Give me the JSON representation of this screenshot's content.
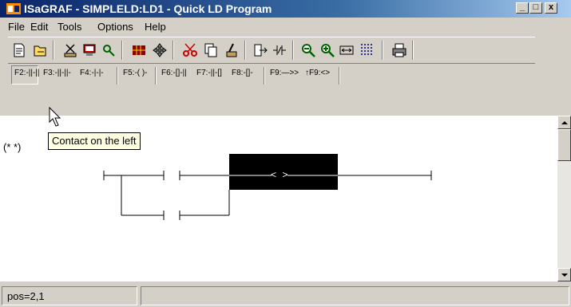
{
  "window": {
    "title": "ISaGRAF - SIMPLELD:LD1 - Quick LD Program",
    "controls": [
      "_",
      "□",
      "x"
    ]
  },
  "menu": [
    "File",
    "Edit",
    "Tools",
    "Options",
    "Help"
  ],
  "toolbar_icons": [
    "new-document-icon",
    "open-icon",
    "cut-icon",
    "monitor-icon",
    "find-icon",
    "grid-icon",
    "move-icon",
    "scissors-icon",
    "copy-icon",
    "paste-icon",
    "exit-icon",
    "contact-icon",
    "zoom-out-icon",
    "zoom-in-icon",
    "fit-icon",
    "dots-grid-icon",
    "print-icon"
  ],
  "fkeys": [
    {
      "key": "F2:",
      "symbol": "-||-||"
    },
    {
      "key": "F3:",
      "symbol": "-||-||-"
    },
    {
      "key": "F4:",
      "symbol": "-|-|-"
    },
    {
      "key": "F5:",
      "symbol": "-( )-"
    },
    {
      "key": "F6:",
      "symbol": "-[]-||"
    },
    {
      "key": "F7:",
      "symbol": "-||-[]"
    },
    {
      "key": "F8:",
      "symbol": "-[]-"
    },
    {
      "key": "F9:",
      "symbol": "—>>"
    },
    {
      "key": "↑F9:",
      "symbol": "<>"
    }
  ],
  "editor": {
    "comment": "(* *)",
    "tooltip": "Contact on the left",
    "coil_text": "< >"
  },
  "status": {
    "pos": "pos=2,1"
  }
}
